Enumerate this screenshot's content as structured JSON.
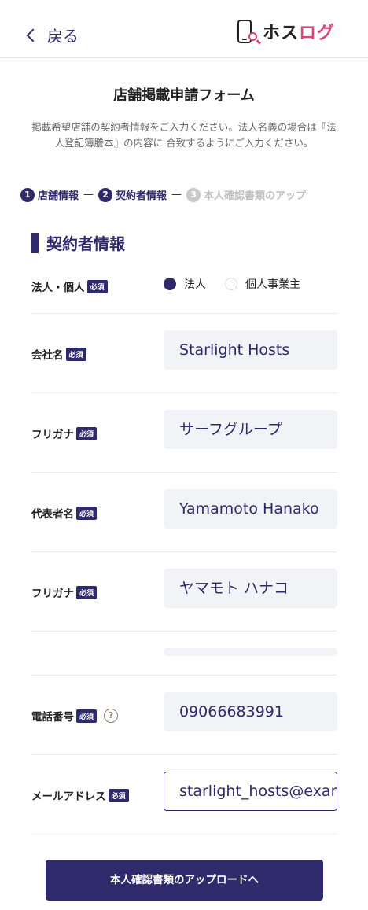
{
  "header": {
    "back_label": "戻る",
    "logo_text_a": "ホス",
    "logo_text_b": "ログ"
  },
  "page": {
    "title": "店舗掲載申請フォーム",
    "description": "掲載希望店舗の契約者情報をご入力ください。法人名義の場合は『法人登記簿謄本』の内容に 合致するようにご入力ください。"
  },
  "steps": [
    {
      "num": "1",
      "label": "店舗情報"
    },
    {
      "num": "2",
      "label": "契約者情報"
    },
    {
      "num": "3",
      "label": "本人確認書類のアップ"
    }
  ],
  "step_separator": "—",
  "section": {
    "title": "契約者情報"
  },
  "required_badge": "必須",
  "form": {
    "type": {
      "label": "法人・個人",
      "options": [
        "法人",
        "個人事業主"
      ],
      "selected": "法人"
    },
    "company": {
      "label": "会社名",
      "value": "Starlight Hosts"
    },
    "company_kana": {
      "label": "フリガナ",
      "value": "サーフグループ"
    },
    "rep_name": {
      "label": "代表者名",
      "value": "Yamamoto Hanako"
    },
    "rep_kana": {
      "label": "フリガナ",
      "value": "ヤマモト ハナコ"
    },
    "phone": {
      "label": "電話番号",
      "value": "09066683991",
      "help": "?"
    },
    "email": {
      "label": "メールアドレス",
      "value": "starlight_hosts@example.com"
    }
  },
  "submit_label": "本人確認書類のアップロードへ"
}
